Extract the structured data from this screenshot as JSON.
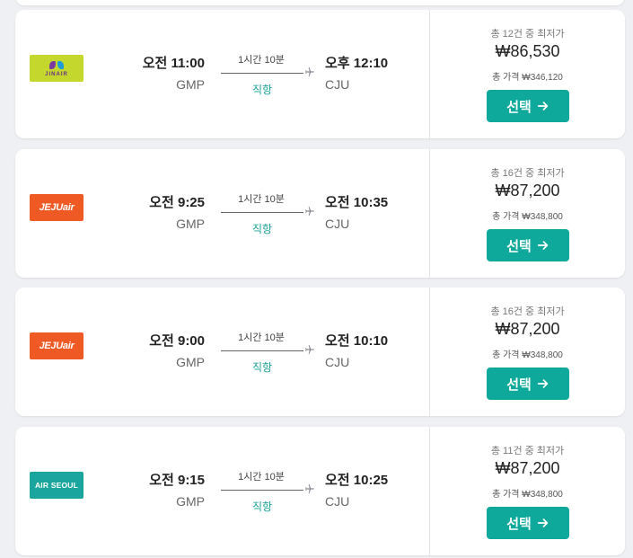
{
  "flights": [
    {
      "airline_logo": "JINAIR",
      "logo_style": "jin",
      "departure_time": "오전 11:00",
      "departure_code": "GMP",
      "duration": "1시간 10분",
      "stops": "직항",
      "arrival_time": "오후 12:10",
      "arrival_code": "CJU",
      "fare_count": "총 12건 중 최저가",
      "price": "₩86,530",
      "total_price": "총 가격 ₩346,120",
      "select_label": "선택"
    },
    {
      "airline_logo": "JEJUair",
      "logo_style": "jeju",
      "departure_time": "오전 9:25",
      "departure_code": "GMP",
      "duration": "1시간 10분",
      "stops": "직항",
      "arrival_time": "오전 10:35",
      "arrival_code": "CJU",
      "fare_count": "총 16건 중 최저가",
      "price": "₩87,200",
      "total_price": "총 가격 ₩348,800",
      "select_label": "선택"
    },
    {
      "airline_logo": "JEJUair",
      "logo_style": "jeju",
      "departure_time": "오전 9:00",
      "departure_code": "GMP",
      "duration": "1시간 10분",
      "stops": "직항",
      "arrival_time": "오전 10:10",
      "arrival_code": "CJU",
      "fare_count": "총 16건 중 최저가",
      "price": "₩87,200",
      "total_price": "총 가격 ₩348,800",
      "select_label": "선택"
    },
    {
      "airline_logo": "AIR SEOUL",
      "logo_style": "seoul",
      "departure_time": "오전 9:15",
      "departure_code": "GMP",
      "duration": "1시간 10분",
      "stops": "직항",
      "arrival_time": "오전 10:25",
      "arrival_code": "CJU",
      "fare_count": "총 11건 중 최저가",
      "price": "₩87,200",
      "total_price": "총 가격 ₩348,800",
      "select_label": "선택"
    }
  ],
  "colors": {
    "accent": "#0ea99b",
    "direct_text": "#1aa096",
    "page_background": "#eff0f3"
  },
  "icons": {
    "plane": "plane-icon",
    "arrow": "arrow-right-icon"
  }
}
